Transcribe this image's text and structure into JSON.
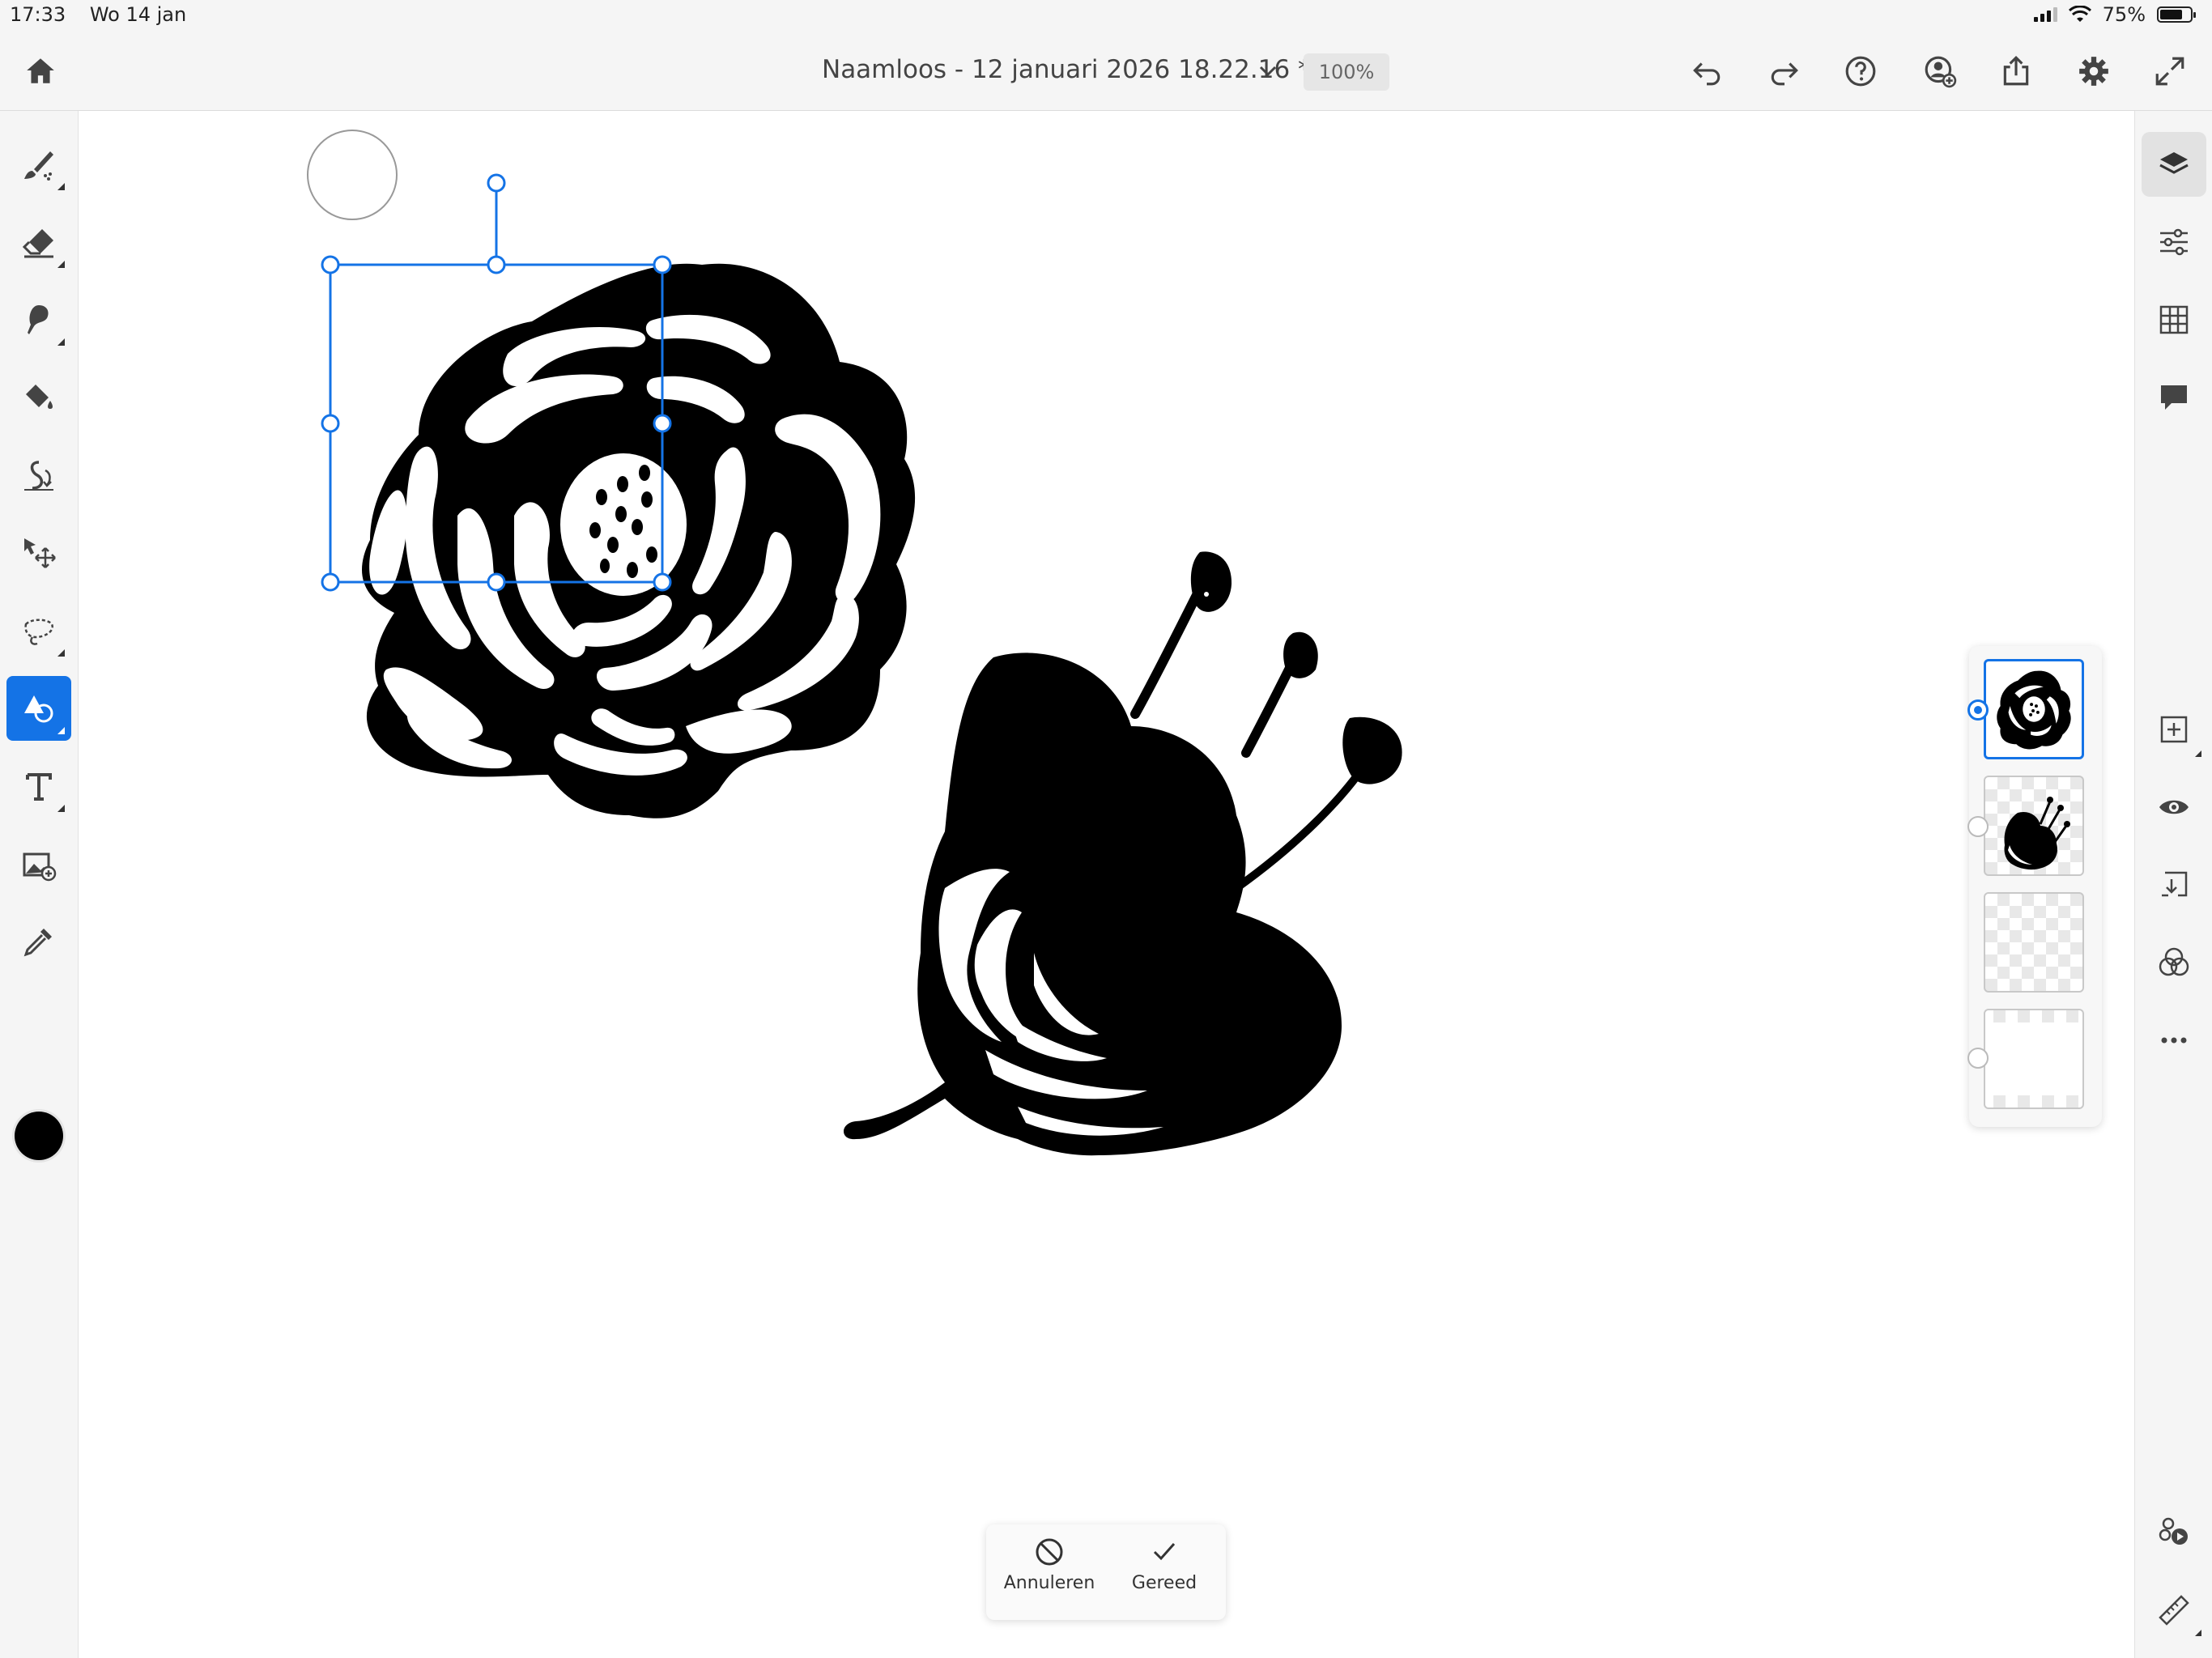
{
  "status_bar": {
    "time": "17:33",
    "date": "Wo 14 jan",
    "battery": "75%",
    "battery_level": 0.75
  },
  "document": {
    "title": "Naamloos - 12 januari 2026 18.22.16 *",
    "zoom": "100%"
  },
  "topbar": {
    "left_icons": [
      "home-icon"
    ],
    "right_icons": [
      "undo-icon",
      "redo-icon",
      "help-icon",
      "invite-user-icon",
      "share-icon",
      "settings-icon",
      "fullscreen-icon"
    ]
  },
  "left_toolbar": {
    "tools": [
      "brush-tool",
      "eraser-tool",
      "smudge-tool",
      "fill-tool",
      "liquify-tool",
      "transform-tool",
      "lasso-tool",
      "shape-tool",
      "text-tool",
      "place-image-tool",
      "eyedropper-tool"
    ],
    "active_tool": "shape-tool",
    "current_color": "#000000"
  },
  "right_toolbar": {
    "top_icons": [
      "layers-icon",
      "adjustments-icon",
      "grid-icon",
      "comments-icon"
    ],
    "layer_actions": [
      "add-layer-icon",
      "visibility-icon",
      "merge-down-icon",
      "blend-mode-icon",
      "more-icon"
    ],
    "bottom_icons": [
      "livestream-icon",
      "ruler-icon"
    ]
  },
  "layers": [
    {
      "name": "flower-layer",
      "selected": true
    },
    {
      "name": "bird-layer",
      "selected": false
    },
    {
      "name": "empty-layer",
      "selected": false
    },
    {
      "name": "background-layer",
      "selected": false
    }
  ],
  "confirm_bar": {
    "cancel_label": "Annuleren",
    "done_label": "Gereed"
  },
  "colors": {
    "accent": "#1473e6",
    "toolbar_bg": "#f5f5f5",
    "ink": "#000000"
  }
}
